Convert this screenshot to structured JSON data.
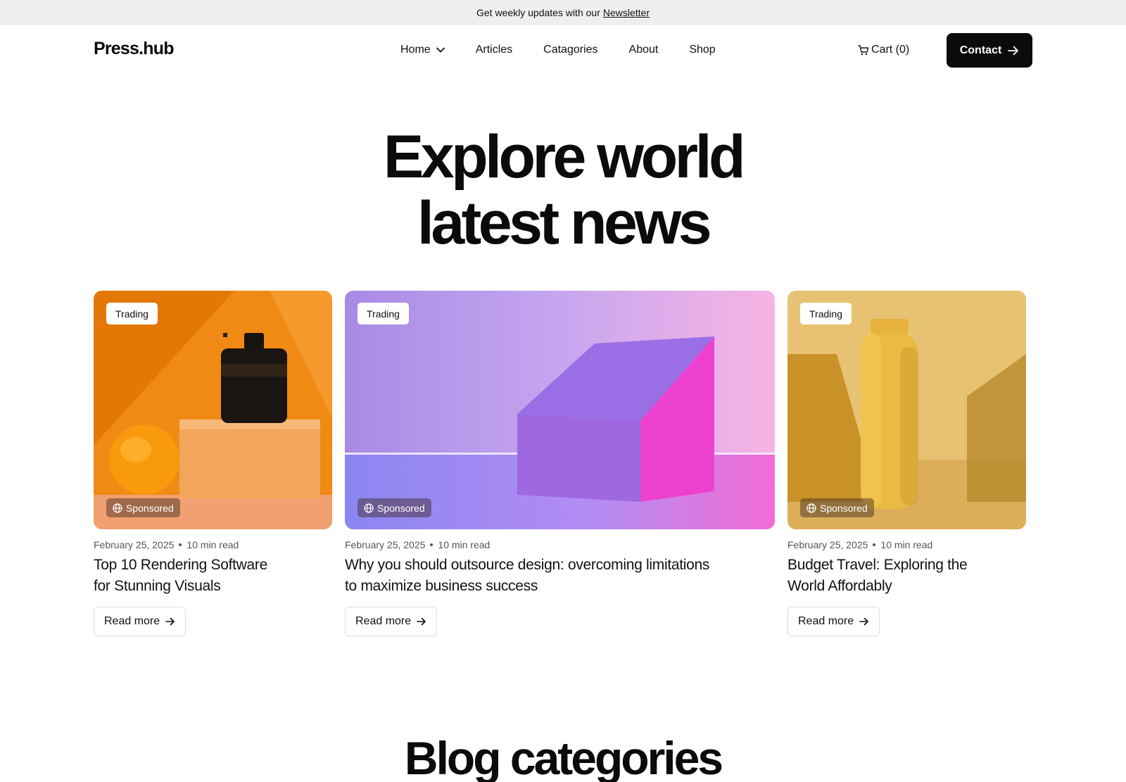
{
  "announcement": {
    "text": "Get weekly updates with our",
    "link": "Newsletter"
  },
  "header": {
    "logo": "Press.hub",
    "nav": [
      {
        "label": "Home",
        "has_dropdown": true
      },
      {
        "label": "Articles"
      },
      {
        "label": "Catagories"
      },
      {
        "label": "About"
      },
      {
        "label": "Shop"
      }
    ],
    "cart": "Cart (0)",
    "contact": "Contact"
  },
  "hero": {
    "line1": "Explore world",
    "line2": "latest news"
  },
  "cards": [
    {
      "tag": "Trading",
      "badge": "Sponsored",
      "date": "February 25, 2025",
      "read_time": "10 min read",
      "title_line1": "Top 10 Rendering Software",
      "title_line2": "for Stunning Visuals",
      "cta": "Read more",
      "image": "orange-perfume-still-life"
    },
    {
      "tag": "Trading",
      "badge": "Sponsored",
      "date": "February 25, 2025",
      "read_time": "10 min read",
      "title_line1": "Why you should outsource design: overcoming limitations",
      "title_line2": "to maximize business success",
      "cta": "Read more",
      "image": "purple-pink-block-render"
    },
    {
      "tag": "Trading",
      "badge": "Sponsored",
      "date": "February 25, 2025",
      "read_time": "10 min read",
      "title_line1": "Budget Travel: Exploring the",
      "title_line2": "World Affordably",
      "cta": "Read more",
      "image": "yellow-bottle-still-life"
    }
  ],
  "section": {
    "title": "Blog categories"
  },
  "colors": {
    "primary": "#0b0b0b",
    "topbar_bg": "#efefef",
    "border": "#dedede"
  }
}
